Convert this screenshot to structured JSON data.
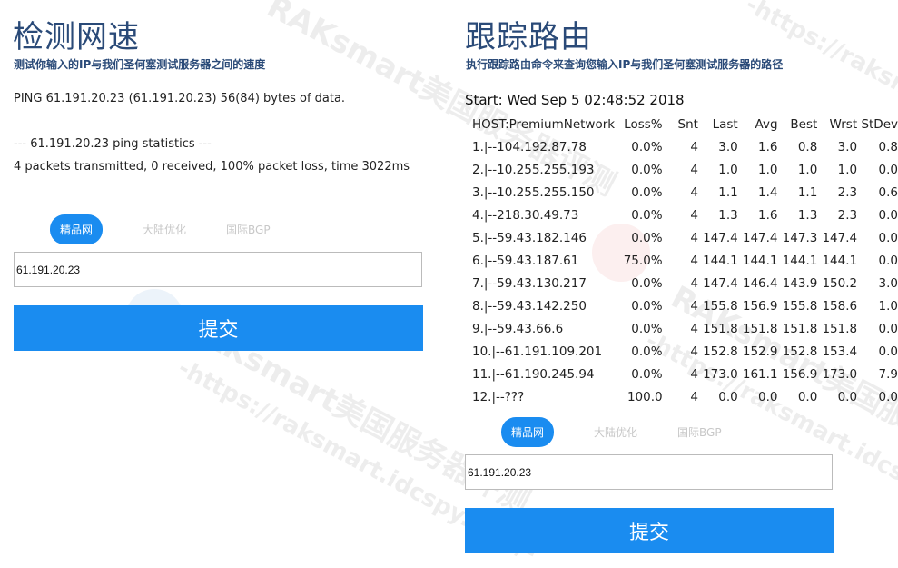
{
  "left": {
    "title": "检测网速",
    "subtitle": "测试你输入的IP与我们圣何塞测试服务器之间的速度",
    "output": {
      "line1": "PING 61.191.20.23 (61.191.20.23) 56(84) bytes of data.",
      "line2": "--- 61.191.20.23 ping statistics ---",
      "line3": "4 packets transmitted, 0 received, 100% packet loss, time 3022ms"
    },
    "tabs": [
      "精品网",
      "大陆优化",
      "国际BGP"
    ],
    "input_value": "61.191.20.23",
    "submit_label": "提交"
  },
  "right": {
    "title": "跟踪路由",
    "subtitle": "执行跟踪路由命令来查询您输入IP与我们圣何塞测试服务器的路径",
    "start_line": "Start: Wed Sep  5 02:48:52 2018",
    "headers": [
      "HOST:PremiumNetwork",
      "Loss%",
      "Snt",
      "Last",
      "Avg",
      "Best",
      "Wrst",
      "StDev"
    ],
    "rows": [
      [
        "1.|--104.192.87.78",
        "0.0%",
        "4",
        "3.0",
        "1.6",
        "0.8",
        "3.0",
        "0.8"
      ],
      [
        "2.|--10.255.255.193",
        "0.0%",
        "4",
        "1.0",
        "1.0",
        "1.0",
        "1.0",
        "0.0"
      ],
      [
        "3.|--10.255.255.150",
        "0.0%",
        "4",
        "1.1",
        "1.4",
        "1.1",
        "2.3",
        "0.6"
      ],
      [
        "4.|--218.30.49.73",
        "0.0%",
        "4",
        "1.3",
        "1.6",
        "1.3",
        "2.3",
        "0.0"
      ],
      [
        "5.|--59.43.182.146",
        "0.0%",
        "4",
        "147.4",
        "147.4",
        "147.3",
        "147.4",
        "0.0"
      ],
      [
        "6.|--59.43.187.61",
        "75.0%",
        "4",
        "144.1",
        "144.1",
        "144.1",
        "144.1",
        "0.0"
      ],
      [
        "7.|--59.43.130.217",
        "0.0%",
        "4",
        "147.4",
        "146.4",
        "143.9",
        "150.2",
        "3.0"
      ],
      [
        "8.|--59.43.142.250",
        "0.0%",
        "4",
        "155.8",
        "156.9",
        "155.8",
        "158.6",
        "1.0"
      ],
      [
        "9.|--59.43.66.6",
        "0.0%",
        "4",
        "151.8",
        "151.8",
        "151.8",
        "151.8",
        "0.0"
      ],
      [
        "10.|--61.191.109.201",
        "0.0%",
        "4",
        "152.8",
        "152.9",
        "152.8",
        "153.4",
        "0.0"
      ],
      [
        "11.|--61.190.245.94",
        "0.0%",
        "4",
        "173.0",
        "161.1",
        "156.9",
        "173.0",
        "7.9"
      ],
      [
        "12.|--???",
        "100.0",
        "4",
        "0.0",
        "0.0",
        "0.0",
        "0.0",
        "0.0"
      ]
    ],
    "tabs": [
      "精品网",
      "大陆优化",
      "国际BGP"
    ],
    "input_value": "61.191.20.23",
    "submit_label": "提交"
  },
  "watermark": {
    "text1": "RAKsmart美国服务器评测",
    "text2": "-https://raksmart.idcspy.com/-"
  },
  "colors": {
    "accent": "#1a8cf0",
    "title": "#2a4a78"
  }
}
